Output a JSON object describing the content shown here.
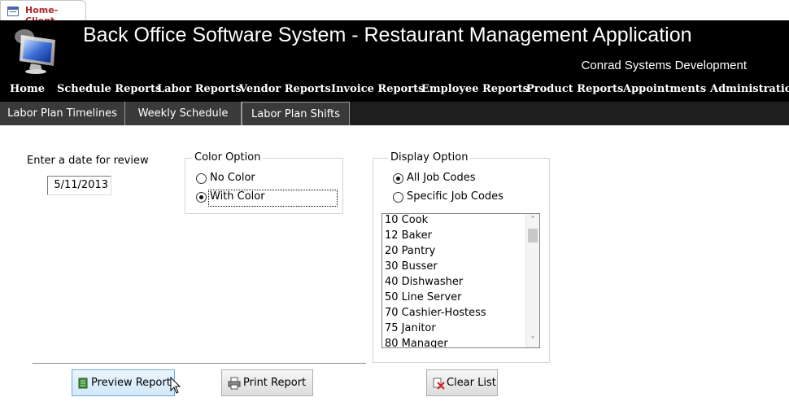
{
  "document_tab": {
    "label": "Home-Client",
    "icon": "form-icon"
  },
  "header": {
    "title": "Back Office Software System - Restaurant Management Application",
    "subtitle": "Conrad Systems Development",
    "logo_icon": "computer-monitor-icon",
    "background": "#000000"
  },
  "menu": {
    "items": [
      {
        "label": "Home"
      },
      {
        "label": "Schedule Reports"
      },
      {
        "label": "Labor Reports"
      },
      {
        "label": "Vendor Reports"
      },
      {
        "label": "Invoice Reports"
      },
      {
        "label": "Employee Reports"
      },
      {
        "label": "Product Reports"
      },
      {
        "label": "Appointments"
      },
      {
        "label": "Administration"
      }
    ]
  },
  "subtabs": [
    {
      "label": "Labor Plan Timelines"
    },
    {
      "label": "Weekly Schedule"
    },
    {
      "label": "Labor Plan Shifts"
    }
  ],
  "form": {
    "date_label": "Enter a date for review",
    "date_value": "5/11/2013",
    "color_option": {
      "title": "Color Option",
      "options": [
        {
          "label": "No Color",
          "selected": false
        },
        {
          "label": "With Color",
          "selected": true
        }
      ]
    },
    "display_option": {
      "title": "Display Option",
      "options": [
        {
          "label": "All Job Codes",
          "selected": true
        },
        {
          "label": "Specific Job Codes",
          "selected": false
        }
      ]
    },
    "job_codes": [
      "10 Cook",
      "12 Baker",
      "20 Pantry",
      "30 Busser",
      "40 Dishwasher",
      "50 Line Server",
      "70 Cashier-Hostess",
      "75 Janitor",
      "80 Manager"
    ]
  },
  "buttons": {
    "preview": {
      "label": "Preview Report",
      "icon": "preview-report-icon"
    },
    "print": {
      "label": "Print Report",
      "icon": "printer-icon"
    },
    "clear": {
      "label": "Clear List",
      "icon": "clear-list-icon"
    }
  },
  "colors": {
    "tab_label": "#b1262e",
    "hover_button": "#d2e8fa"
  }
}
